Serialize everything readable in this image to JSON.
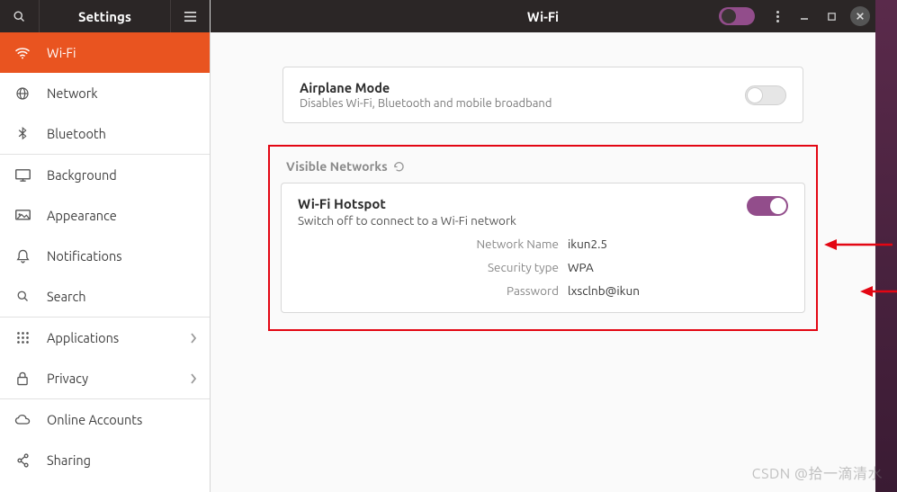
{
  "sidebar": {
    "title": "Settings",
    "items": [
      {
        "label": "Wi-Fi"
      },
      {
        "label": "Network"
      },
      {
        "label": "Bluetooth"
      },
      {
        "label": "Background"
      },
      {
        "label": "Appearance"
      },
      {
        "label": "Notifications"
      },
      {
        "label": "Search"
      },
      {
        "label": "Applications"
      },
      {
        "label": "Privacy"
      },
      {
        "label": "Online Accounts"
      },
      {
        "label": "Sharing"
      }
    ]
  },
  "header": {
    "title": "Wi-Fi"
  },
  "airplane": {
    "title": "Airplane Mode",
    "subtitle": "Disables Wi-Fi, Bluetooth and mobile broadband"
  },
  "visible_networks_label": "Visible Networks",
  "hotspot": {
    "title": "Wi-Fi Hotspot",
    "subtitle": "Switch off to connect to a Wi-Fi network",
    "network_name_label": "Network Name",
    "network_name_value": "ikun2.5",
    "security_label": "Security type",
    "security_value": "WPA",
    "password_label": "Password",
    "password_value": "lxsclnb@ikun"
  },
  "watermark": "CSDN @拾一滴清水"
}
